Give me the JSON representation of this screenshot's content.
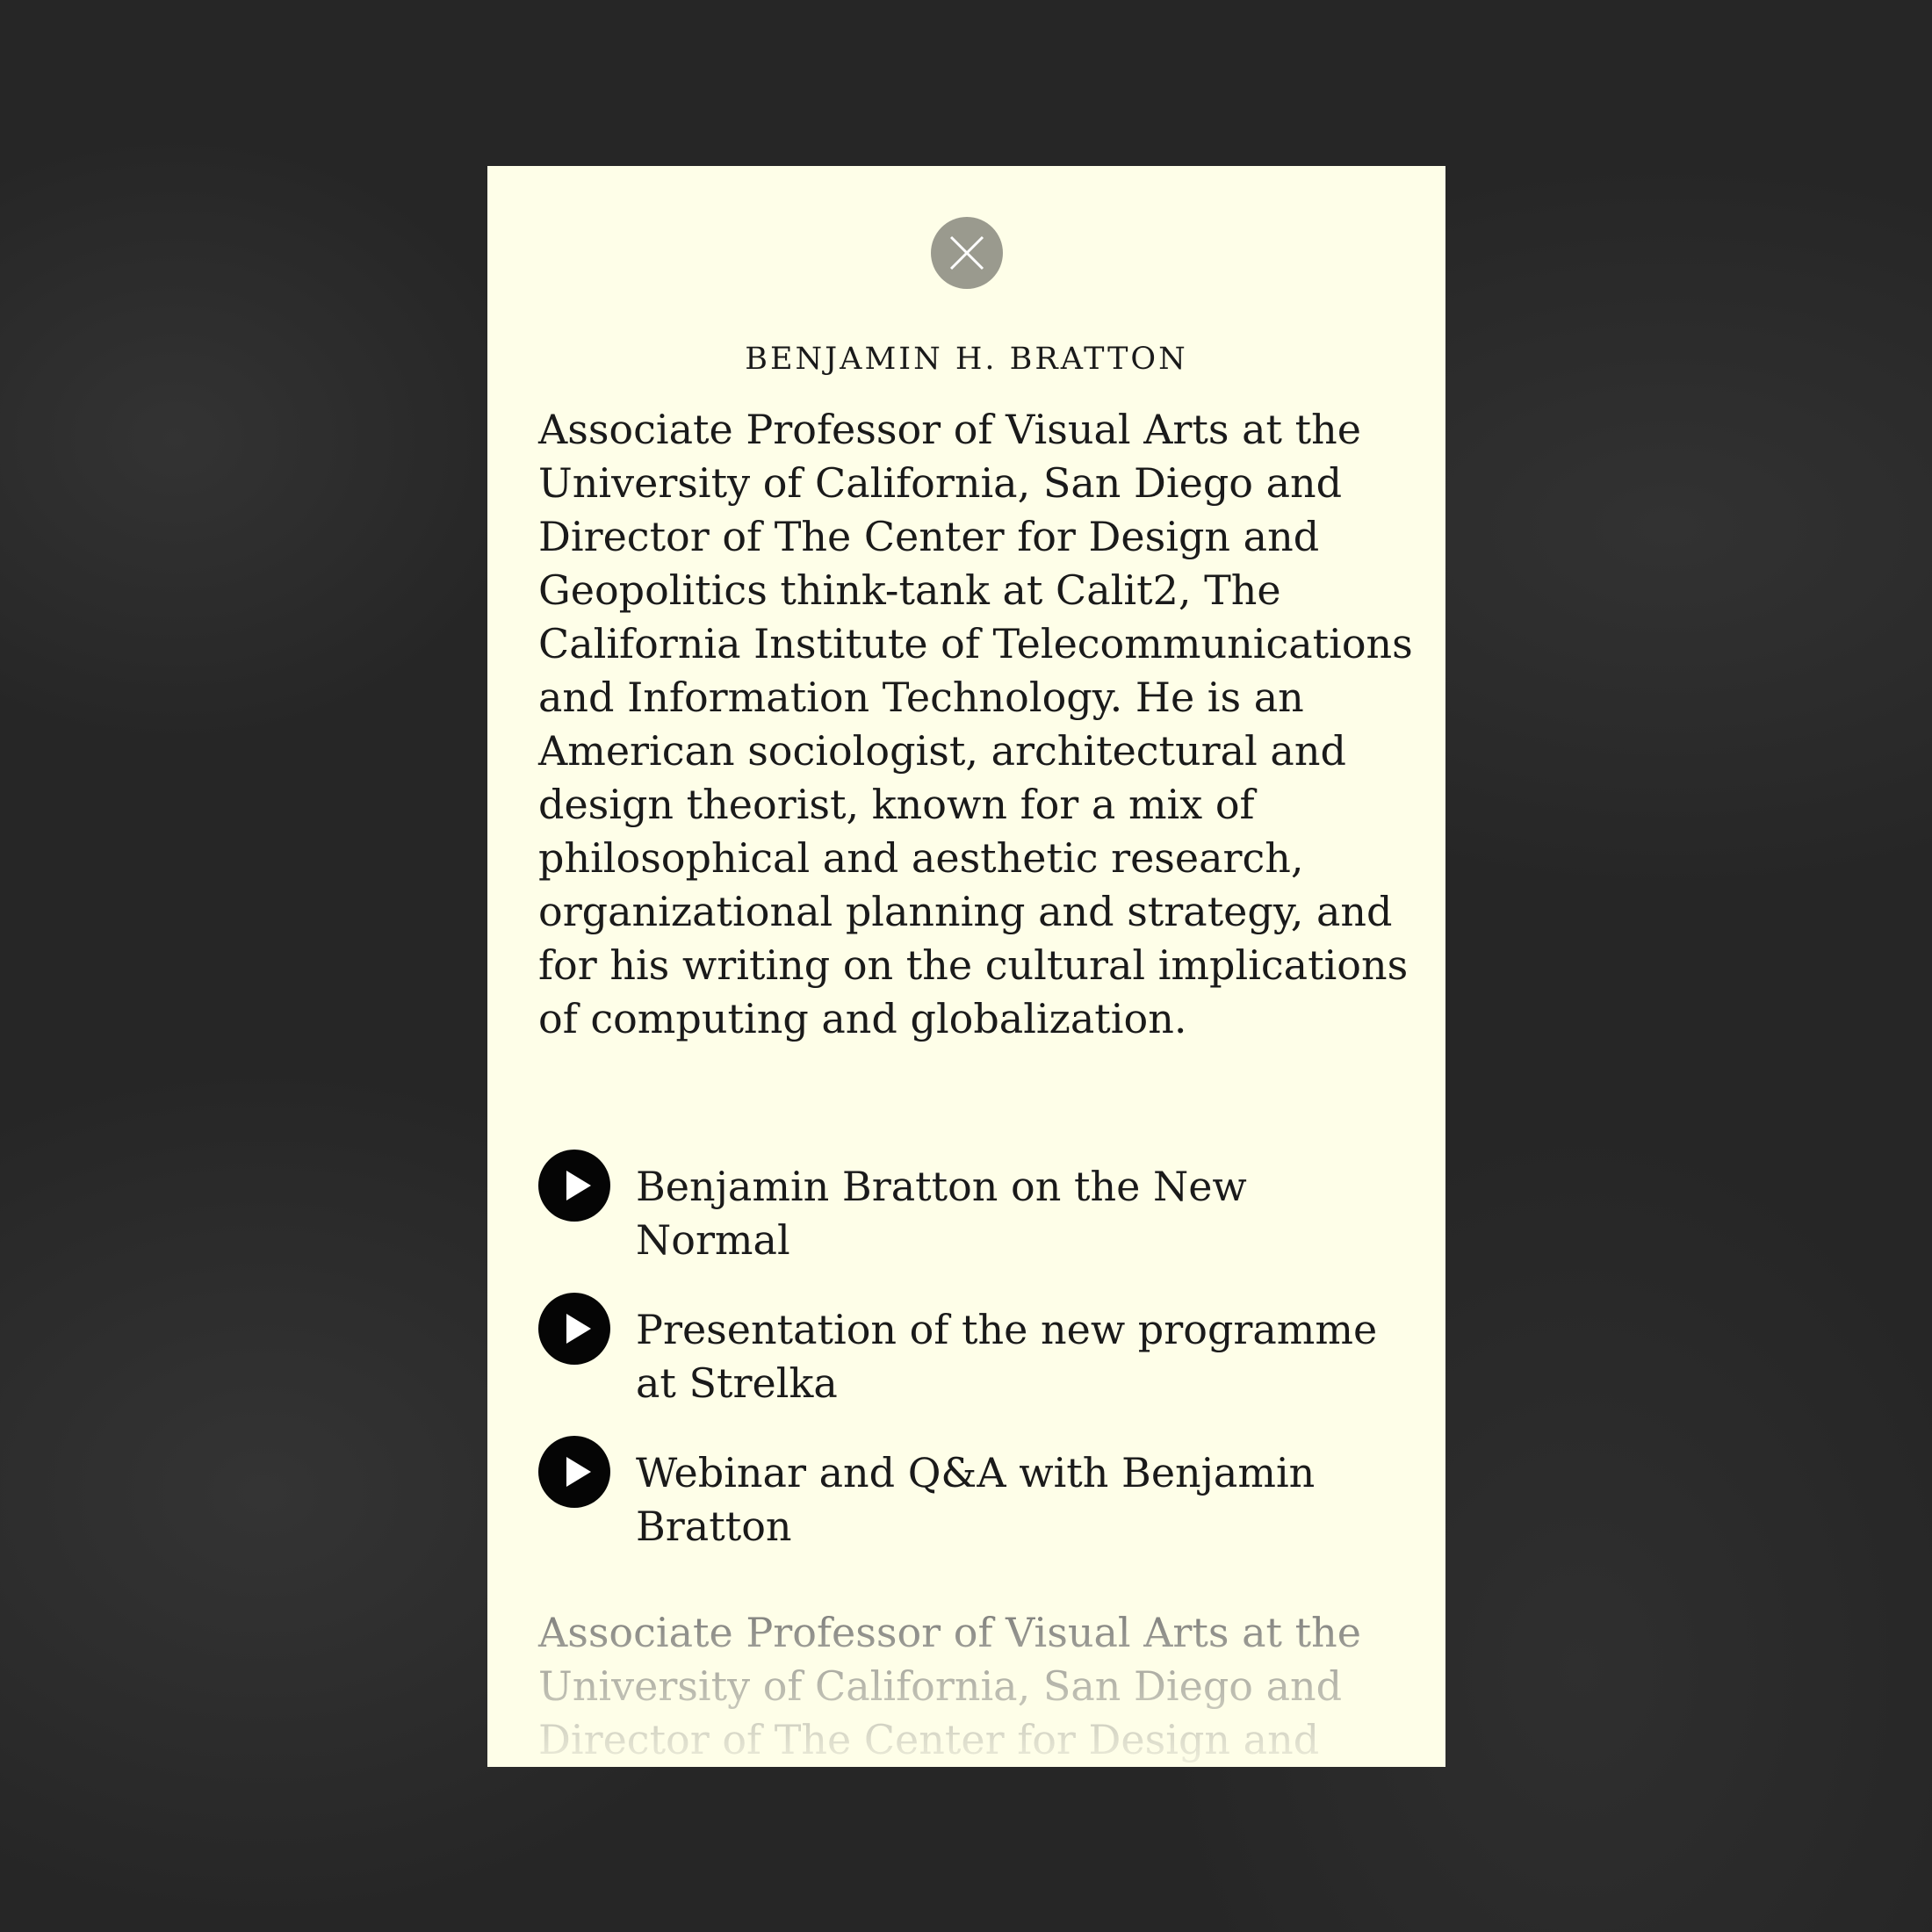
{
  "modal": {
    "close_icon": "close-icon",
    "person_name": "BENJAMIN H. BRATTON",
    "bio": "Associate Professor of Visual Arts at the University of California, San Diego and Director of The Center for Design and Geopolitics think-tank at Calit2, The California Institute of Telecommunications and Information Technology. He is an American sociologist, architectural and design theorist, known for a mix of philosophical and aesthetic research, organizational planning and strategy, and for his writing on the cultural implications of computing and globalization.",
    "videos": [
      {
        "icon": "play-icon",
        "title": "Benjamin Bratton on the New Normal"
      },
      {
        "icon": "play-icon",
        "title": "Presentation of the new programme at Strelka"
      },
      {
        "icon": "play-icon",
        "title": "Webinar and Q&A with Benjamin Bratton"
      }
    ],
    "bio_repeat": "Associate Professor of Visual Arts at the University of California, San Diego and Director of The Center for Design and"
  },
  "colors": {
    "modal_background": "#fefee8",
    "backdrop": "#262626",
    "close_button": "#9a9a8e",
    "text": "#1a1a1a"
  }
}
